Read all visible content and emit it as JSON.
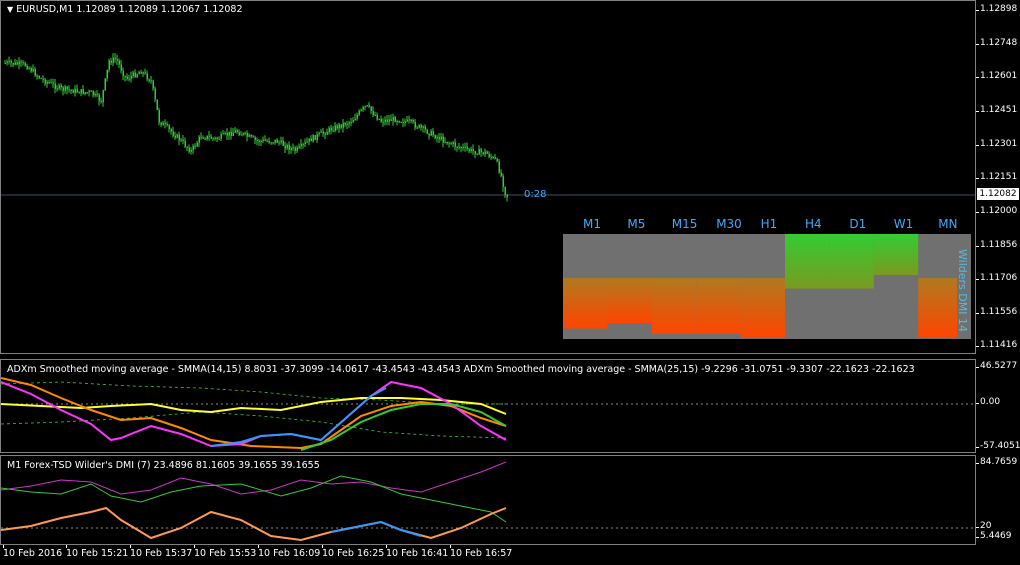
{
  "main": {
    "title": "EURUSD,M1  1.12089 1.12089 1.12067 1.12082",
    "countdown": "0:28",
    "price_tag": "1.12082",
    "scale": [
      "1.12898",
      "1.12748",
      "1.12601",
      "1.12451",
      "1.12301",
      "1.12151",
      "1.12000",
      "1.11856",
      "1.11706",
      "1.11556",
      "1.11416"
    ],
    "timeframes": [
      "M1",
      "M5",
      "M15",
      "M30",
      "H1",
      "H4",
      "D1",
      "W1",
      "MN"
    ],
    "panel_label": "Wilders DMI 14",
    "colors": {
      "candle": "#33cc33",
      "accent": "#3fa9ff",
      "orange": "#ff4500",
      "gray": "#707070"
    },
    "tf_levels": [
      {
        "top": 0.0,
        "mid": 0.42,
        "low": 0.84
      },
      {
        "top": 0.0,
        "mid": 0.42,
        "low": 0.79
      },
      {
        "top": 0.0,
        "mid": 0.42,
        "low": 0.89
      },
      {
        "top": 0.0,
        "mid": 0.42,
        "low": 0.89
      },
      {
        "top": 0.0,
        "mid": 0.42,
        "low": 0.93
      },
      {
        "top": 1.0,
        "mid": 0.52,
        "low": 0.0
      },
      {
        "top": 1.0,
        "mid": 0.52,
        "low": 0.0
      },
      {
        "top": 0.75,
        "mid": 0.52,
        "low": 0.0
      },
      {
        "top": 0.0,
        "mid": 0.42,
        "low": 0.93
      }
    ]
  },
  "ind1": {
    "title": "ADXm Smoothed moving average - SMMA(14,15) 8.8031 -37.3099 -14.0617 -43.4543 -43.4543  ADXm Smoothed moving average - SMMA(25,15) -9.2296 -31.0751 -9.3307 -22.1623 -22.1623",
    "scale": [
      "46.5277",
      "0.00",
      "-57.4051"
    ]
  },
  "ind2": {
    "title": "M1 Forex-TSD Wilder's DMI (7) 23.4896 81.1605 39.1655 39.1655",
    "scale": [
      "84.7659",
      "20",
      "5.4469"
    ]
  },
  "x_axis": [
    "10 Feb 2016",
    "10 Feb 15:21",
    "10 Feb 15:37",
    "10 Feb 15:53",
    "10 Feb 16:09",
    "10 Feb 16:25",
    "10 Feb 16:41",
    "10 Feb 16:57"
  ]
}
